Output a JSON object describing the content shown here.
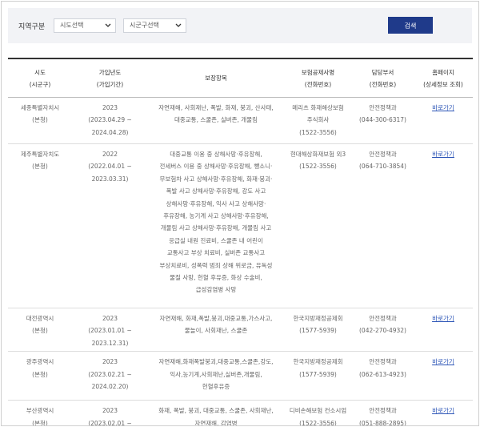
{
  "filter": {
    "label": "지역구분",
    "sido_select": "시도선택",
    "sigungu_select": "시군구선택",
    "search_button": "검색"
  },
  "table": {
    "headers": [
      {
        "line1": "시도",
        "line2": "(시군구)"
      },
      {
        "line1": "가입년도",
        "line2": "(가입기간)"
      },
      {
        "line1": "보장항목",
        "line2": ""
      },
      {
        "line1": "보험공제사명",
        "line2": "(전화번호)"
      },
      {
        "line1": "담당부서",
        "line2": "(전화번호)"
      },
      {
        "line1": "홈페이지",
        "line2": "(상세정보 조회)"
      }
    ],
    "rows": [
      {
        "region": "세종특별자치시",
        "subregion": "(본청)",
        "year": "2023",
        "period": "(2023.04.29 ~ 2024.04.28)",
        "items": [
          "자연재해, 사회재난, 폭발, 화재, 붕괴, 산사태,",
          "대중교통, 스쿨존, 실버존, 개물림"
        ],
        "insurer": [
          "메리츠 화재해상보험",
          "주식회사"
        ],
        "insurer_phone": "(1522-3556)",
        "dept": "안전정책과",
        "dept_phone": "(044-300-6317)",
        "link": "바로가기"
      },
      {
        "region": "제주특별자치도",
        "subregion": "(본청)",
        "year": "2022",
        "period": "(2022.04.01 ~ 2023.03.31)",
        "items": [
          "대중교통 이용 중 상해사망·후유장해,",
          "전세버스 이용 중 상해사망·후유장해, 뺑소니·",
          "무보험차 사고 상해사망·후유장해, 화재·붕괴·",
          "폭발 사고 상해사망·후유장해, 강도 사고",
          "상해사망·후유장해, 익사 사고 상해사망·",
          "후유장해, 농기계 사고 상해사망·후유장해,",
          "개물림 사고 상해사망·후유장해, 개물림 사고",
          "응급실 내원 진료비, 스쿨존 내 어린이",
          "교통사고 부상 치료비, 실버존 교통사고",
          "부상치료비, 성폭력 범죄 상해 위로금, 유독성",
          "물질 사망, 헌혈 후유증, 화상 수술비,",
          "급성감염병 사망"
        ],
        "insurer": [
          "현대해상화재보험 외3"
        ],
        "insurer_phone": "(1522-3556)",
        "dept": "안전정책과",
        "dept_phone": "(064-710-3854)",
        "link": "바로가기"
      },
      {
        "region": "대전광역시",
        "subregion": "(본청)",
        "year": "2023",
        "period": "(2023.01.01 ~ 2023.12.31)",
        "items": [
          "자연재해, 화재,폭발,붕괴,대중교통,가스사고,",
          "물놀이, 사회재난, 스쿨존"
        ],
        "insurer": [
          "한국지방재정공제회"
        ],
        "insurer_phone": "(1577-5939)",
        "dept": "안전정책과",
        "dept_phone": "(042-270-4932)",
        "link": "바로가기"
      },
      {
        "region": "광주광역시",
        "subregion": "(본청)",
        "year": "2023",
        "period": "(2023.02.21 ~ 2024.02.20)",
        "items": [
          "자연재해,화재폭발붕괴,대중교통,스쿨존,강도,",
          "익사,농기계,사회재난,실버존,개물림,",
          "헌혈후유증"
        ],
        "insurer": [
          "한국지방재정공제회"
        ],
        "insurer_phone": "(1577-5939)",
        "dept": "안전정책과",
        "dept_phone": "(062-613-4923)",
        "link": "바로가기"
      },
      {
        "region": "부산광역시",
        "subregion": "(본청)",
        "year": "2023",
        "period": "(2023.02.01 ~ 2024.01.31)",
        "items": [
          "화재, 폭발, 붕괴, 대중교통, 스쿨존, 사회재난,",
          "자연재해, 감염병"
        ],
        "insurer": [
          "디비손해보험 컨소시엄"
        ],
        "insurer_phone": "(1522-3556)",
        "dept": "안전정책과",
        "dept_phone": "(051-888-2895)",
        "link": "바로가기"
      }
    ]
  }
}
